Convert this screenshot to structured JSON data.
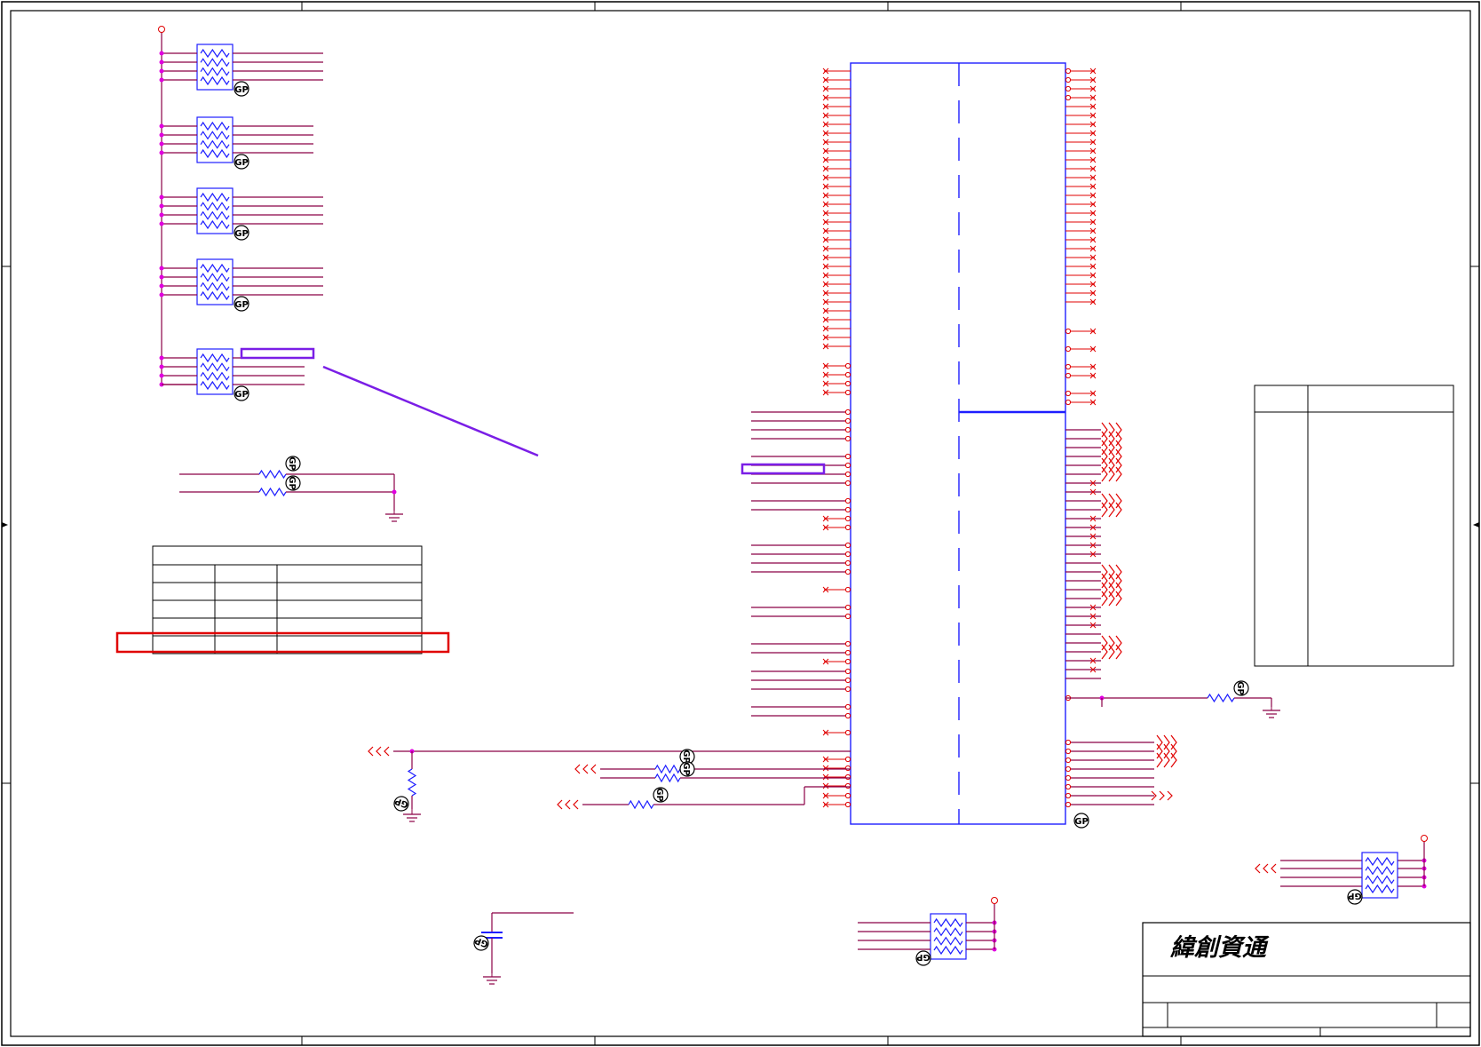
{
  "title_block": {
    "company_name": "緯創資通"
  },
  "icons": {
    "gp_marker": "gp-marker-icon",
    "ground": "ground-icon",
    "resistor_network": "resistor-network-icon",
    "resistor": "resistor-icon",
    "capacitor": "capacitor-icon",
    "power_port": "power-port-icon",
    "offpage_connector": "offpage-connector-icon",
    "no_connect": "no-connect-icon"
  },
  "marker_labels": {
    "gp": "GP"
  },
  "colors": {
    "wire": "#8b0046",
    "pin": "#e00000",
    "component": "#1e1eff",
    "junction": "#e000e0",
    "annotation": "#7a1ee6",
    "highlight": "#e00000",
    "frame": "#000000"
  }
}
